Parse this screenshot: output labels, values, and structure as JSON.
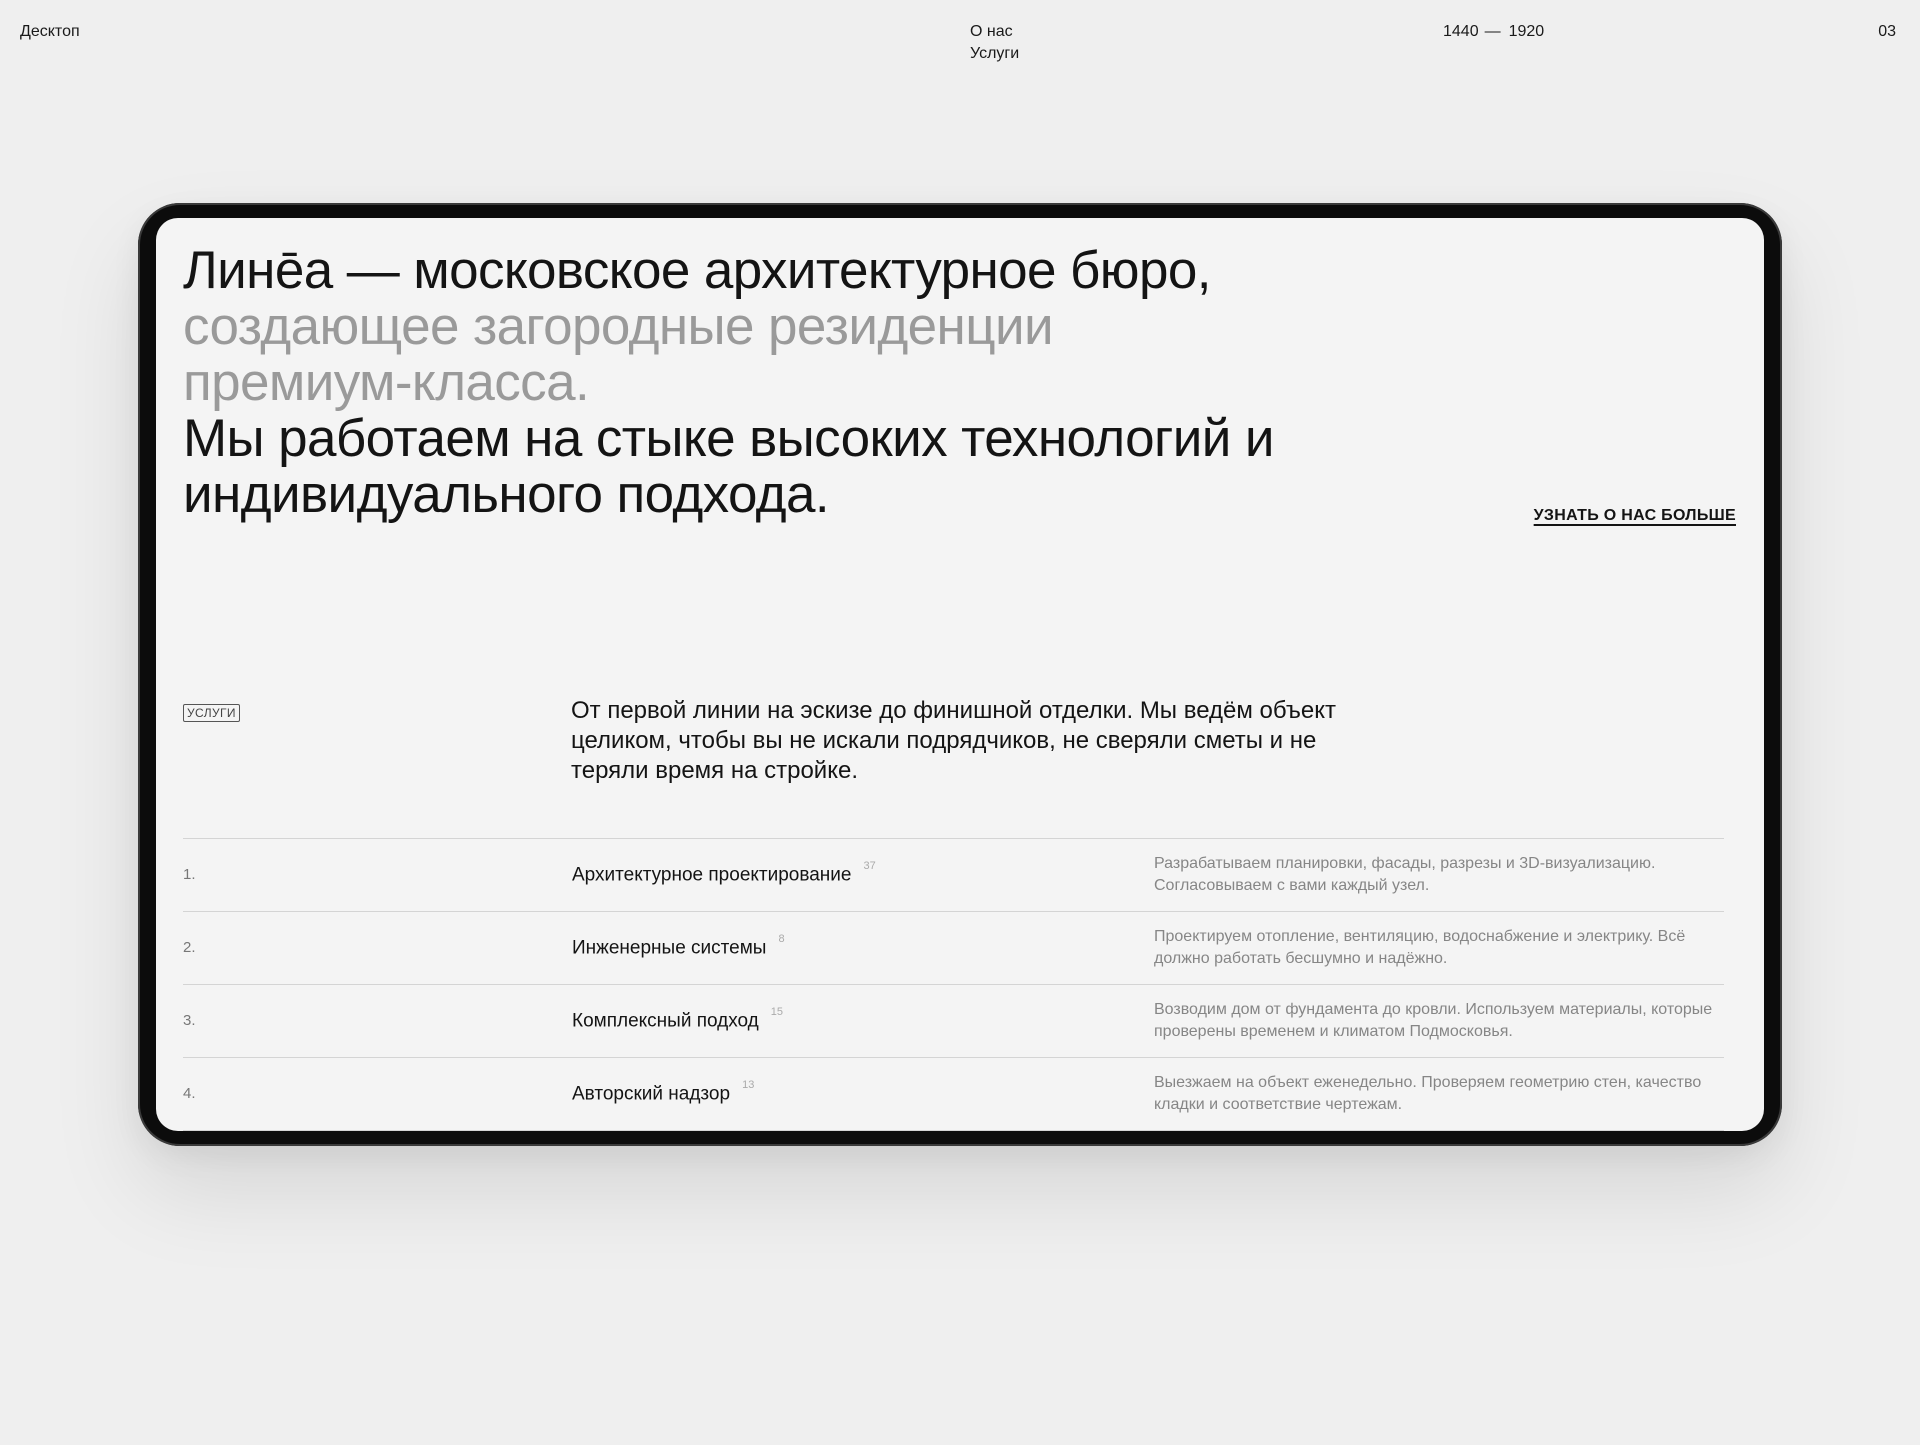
{
  "meta": {
    "label": "Десктоп",
    "nav": [
      "О нас",
      "Услуги"
    ],
    "range_from": "1440",
    "range_sep": "—",
    "range_to": "1920",
    "page_number": "03"
  },
  "hero": {
    "part1": "Линēа — московское архитектурное бюро,",
    "part2": " создающее загородные резиденции премиум-класса.",
    "part3": "Мы работаем на стыке высоких технологий и индивидуального подхода.",
    "more_link": "УЗНАТЬ О НАС БОЛЬШЕ"
  },
  "services": {
    "tag": "УСЛУГИ",
    "lead": "От первой линии на эскизе до финишной отделки. Мы ведём объект целиком, чтобы вы не искали подрядчиков, не сверяли сметы и не теряли время на стройке.",
    "items": [
      {
        "num": "1.",
        "title": "Архитектурное проектирование",
        "count": "37",
        "desc": "Разрабатываем планировки, фасады, разрезы и 3D-визуализацию. Согласовываем с вами каждый узел."
      },
      {
        "num": "2.",
        "title": "Инженерные системы",
        "count": "8",
        "desc": "Проектируем отопление, вентиляцию, водоснабжение и электрику. Всё должно работать бесшумно и надёжно."
      },
      {
        "num": "3.",
        "title": "Комплексный подход",
        "count": "15",
        "desc": "Возводим дом от фундамента до кровли. Используем материалы, которые проверены временем и климатом Подмосковья."
      },
      {
        "num": "4.",
        "title": "Авторский надзор",
        "count": "13",
        "desc": "Выезжаем на объект еженедельно. Проверяем геометрию стен, качество кладки и соответствие чертежам."
      }
    ]
  }
}
